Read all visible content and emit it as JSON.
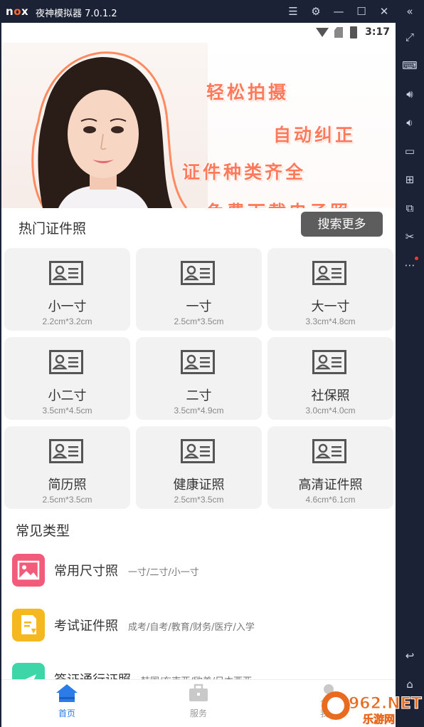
{
  "titlebar": {
    "logo": "nox",
    "title": "夜神模拟器 7.0.1.2",
    "buttons": [
      "menu-icon",
      "gear-icon",
      "minimize-icon",
      "maximize-icon",
      "close-icon",
      "collapse-icon"
    ]
  },
  "statusbar": {
    "time": "3:17"
  },
  "banner": {
    "slogans": [
      "轻松拍摄",
      "自动纠正",
      "证件种类齐全",
      "免费下载电子照"
    ]
  },
  "hot": {
    "title": "热门证件照",
    "search_more": "搜索更多",
    "items": [
      {
        "name": "小一寸",
        "size": "2.2cm*3.2cm"
      },
      {
        "name": "一寸",
        "size": "2.5cm*3.5cm"
      },
      {
        "name": "大一寸",
        "size": "3.3cm*4.8cm"
      },
      {
        "name": "小二寸",
        "size": "3.5cm*4.5cm"
      },
      {
        "name": "二寸",
        "size": "3.5cm*4.9cm"
      },
      {
        "name": "社保照",
        "size": "3.0cm*4.0cm"
      },
      {
        "name": "简历照",
        "size": "2.5cm*3.5cm"
      },
      {
        "name": "健康证照",
        "size": "2.5cm*3.5cm"
      },
      {
        "name": "高清证件照",
        "size": "4.6cm*6.1cm"
      }
    ]
  },
  "common": {
    "title": "常见类型",
    "items": [
      {
        "name": "常用尺寸照",
        "desc": "一寸/二寸/小一寸",
        "icon": "image-icon",
        "color": "#f25c7a"
      },
      {
        "name": "考试证件照",
        "desc": "成考/自考/教育/财务/医疗/入学",
        "icon": "document-icon",
        "color": "#f5b820"
      },
      {
        "name": "签证通行证照",
        "desc": "韩国/东南亚/欧美/日本西亚",
        "icon": "plane-icon",
        "color": "#3dd6a8"
      }
    ]
  },
  "bottomnav": {
    "items": [
      {
        "label": "首页",
        "icon": "home-icon",
        "active": true
      },
      {
        "label": "服务",
        "icon": "briefcase-icon",
        "active": false
      },
      {
        "label": "我的",
        "icon": "user-icon",
        "active": false
      }
    ]
  },
  "colors": {
    "accent": "#2b7ce9",
    "slogan": "#ff7a5a",
    "emulator_bg": "#1b2236"
  },
  "watermark": {
    "text": "962.NET",
    "subtext": "乐游网"
  }
}
